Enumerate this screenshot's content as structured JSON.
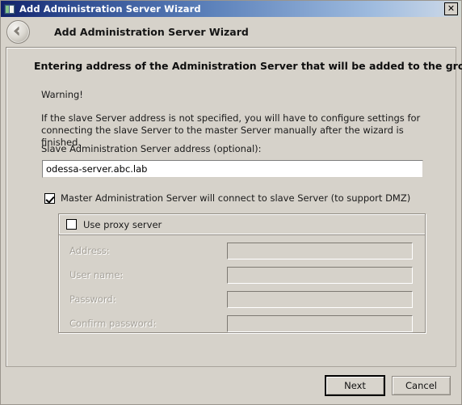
{
  "window": {
    "title": "Add Administration Server Wizard",
    "title_icon": "server-window-icon",
    "close_label": "✕"
  },
  "header": {
    "back_icon": "back-arrow-icon",
    "title": "Add Administration Server Wizard"
  },
  "page": {
    "heading": "Entering address of the Administration Server that will be added to the group",
    "warning_title": "Warning!",
    "warning_body": "If the slave Server address is not specified, you will have to configure settings for connecting the slave Server to the master Server manually after the wizard is finished.",
    "address_label": "Slave Administration Server address (optional):",
    "address_value": "odessa-server.abc.lab",
    "address_placeholder": "",
    "master_checkbox": {
      "label": "Master Administration Server will connect to slave Server (to support DMZ)",
      "checked": true
    },
    "proxy_group": {
      "checkbox_label": "Use proxy server",
      "checked": false,
      "fields": [
        {
          "label": "Address:",
          "value": "",
          "name": "proxy-address-field",
          "disabled": true
        },
        {
          "label": "User name:",
          "value": "",
          "name": "proxy-username-field",
          "disabled": true
        },
        {
          "label": "Password:",
          "value": "",
          "name": "proxy-password-field",
          "disabled": true
        },
        {
          "label": "Confirm password:",
          "value": "",
          "name": "proxy-confirm-password-field",
          "disabled": true
        }
      ]
    }
  },
  "footer": {
    "next_label": "Next",
    "cancel_label": "Cancel"
  },
  "colors": {
    "window_face": "#d6d2ca",
    "titlebar_start": "#11216b",
    "titlebar_end": "#c2d2e6",
    "disabled_text": "#a6a29a",
    "field_background": "#ffffff"
  }
}
